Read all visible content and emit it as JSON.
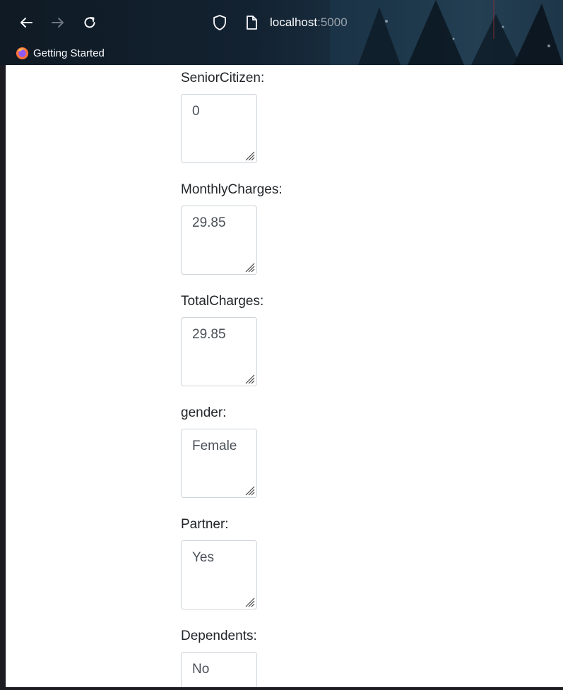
{
  "browser": {
    "url_host": "localhost",
    "url_port": ":5000",
    "bookmarks": [
      {
        "label": "Getting Started",
        "icon": "firefox-icon"
      }
    ],
    "icons": {
      "back": "back-arrow-icon",
      "forward": "forward-arrow-icon",
      "reload": "reload-icon",
      "shield": "shield-icon",
      "page": "page-icon"
    }
  },
  "form": {
    "fields": [
      {
        "label": "SeniorCitizen:",
        "value": "0"
      },
      {
        "label": "MonthlyCharges:",
        "value": "29.85"
      },
      {
        "label": "TotalCharges:",
        "value": "29.85"
      },
      {
        "label": "gender:",
        "value": "Female"
      },
      {
        "label": "Partner:",
        "value": "Yes"
      },
      {
        "label": "Dependents:",
        "value": "No"
      }
    ]
  },
  "colors": {
    "label_text": "#212529",
    "value_text": "#495057",
    "border": "#ced4da",
    "toolbar_bg": "#132231"
  }
}
